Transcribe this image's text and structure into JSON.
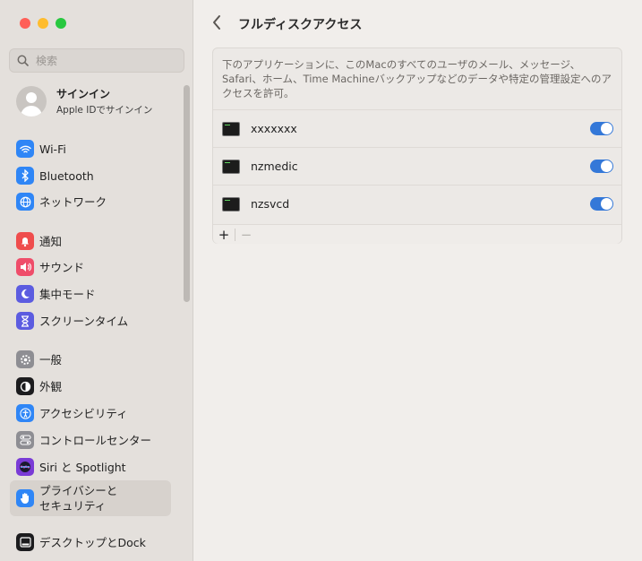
{
  "sidebar": {
    "search_placeholder": "検索",
    "account": {
      "name": "サインイン",
      "subtitle": "Apple IDでサインイン"
    },
    "groups": [
      [
        {
          "label": "Wi-Fi",
          "icon": "wifi-icon",
          "color": "#2f86f6"
        },
        {
          "label": "Bluetooth",
          "icon": "bluetooth-icon",
          "color": "#2f86f6"
        },
        {
          "label": "ネットワーク",
          "icon": "globe-icon",
          "color": "#2f86f6"
        }
      ],
      [
        {
          "label": "通知",
          "icon": "bell-icon",
          "color": "#ef4d4d"
        },
        {
          "label": "サウンド",
          "icon": "speaker-icon",
          "color": "#ef4d6a"
        },
        {
          "label": "集中モード",
          "icon": "moon-icon",
          "color": "#5c5ce0"
        },
        {
          "label": "スクリーンタイム",
          "icon": "hourglass-icon",
          "color": "#5c5ce0"
        }
      ],
      [
        {
          "label": "一般",
          "icon": "gear-icon",
          "color": "#8e8e93"
        },
        {
          "label": "外観",
          "icon": "appearance-icon",
          "color": "#1c1c1e"
        },
        {
          "label": "アクセシビリティ",
          "icon": "accessibility-icon",
          "color": "#2f86f6"
        },
        {
          "label": "コントロールセンター",
          "icon": "control-center-icon",
          "color": "#8e8e93"
        },
        {
          "label": "Siri と Spotlight",
          "icon": "siri-icon",
          "color": "#7a3bd6"
        },
        {
          "label": "プライバシーと\nセキュリティ",
          "icon": "hand-icon",
          "color": "#2f86f6",
          "selected": true
        }
      ],
      [
        {
          "label": "デスクトップとDock",
          "icon": "dock-icon",
          "color": "#1c1c1e"
        }
      ]
    ]
  },
  "main": {
    "title": "フルディスクアクセス",
    "description": "下のアプリケーションに、このMacのすべてのユーザのメール、メッセージ、Safari、ホーム、Time Machineバックアップなどのデータや特定の管理設定へのアクセスを許可。",
    "apps": [
      {
        "name": "xxxxxxx",
        "enabled": true
      },
      {
        "name": "nzmedic",
        "enabled": true
      },
      {
        "name": "nzsvcd",
        "enabled": true
      }
    ],
    "footer": {
      "add_label": "+",
      "remove_label": "−"
    }
  },
  "colors": {
    "accent": "#3478d8",
    "close": "#ff5f57",
    "minimize": "#febc2e",
    "zoom": "#28c840"
  }
}
